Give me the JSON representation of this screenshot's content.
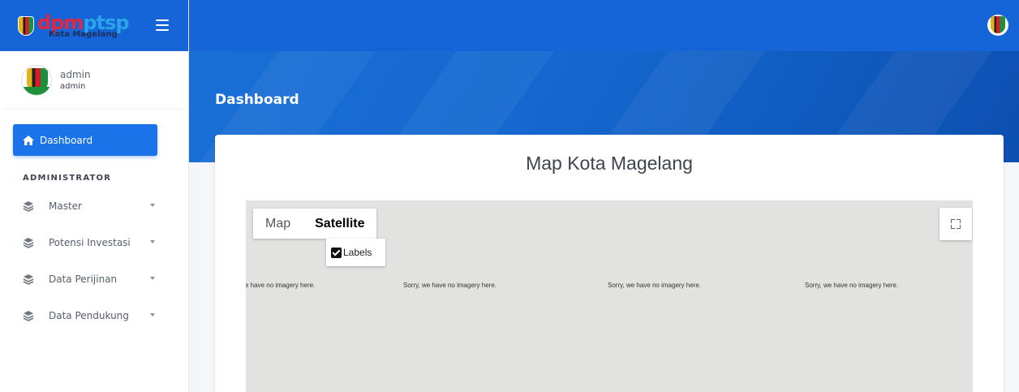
{
  "brand": {
    "logo_part1": "dpm",
    "logo_part2": "ptsp",
    "subtitle": "Kota Magelang"
  },
  "user": {
    "name": "admin",
    "role": "admin"
  },
  "page": {
    "title": "Dashboard"
  },
  "sidebar": {
    "active_item": "Dashboard",
    "section_header": "ADMINISTRATOR",
    "items": [
      {
        "label": "Master"
      },
      {
        "label": "Potensi Investasi"
      },
      {
        "label": "Data Perijinan"
      },
      {
        "label": "Data Pendukung"
      }
    ]
  },
  "card": {
    "title": "Map Kota Magelang"
  },
  "map": {
    "type_options": [
      "Map",
      "Satellite"
    ],
    "selected_type": "Satellite",
    "labels_checkbox": "Labels",
    "labels_checked": true,
    "tile_messages": [
      "e have no imagery here.",
      "Sorry, we have no imagery here.",
      "Sorry, we have no imagery here.",
      "Sorry, we have no imagery here."
    ]
  },
  "colors": {
    "primary": "#1565d8",
    "active_nav": "#1a73e8",
    "map_background": "#e2e2e0"
  },
  "icons": {
    "menu": "hamburger-icon",
    "home": "home-icon",
    "nav_items": "layers-icon",
    "fullscreen": "fullscreen-icon"
  }
}
